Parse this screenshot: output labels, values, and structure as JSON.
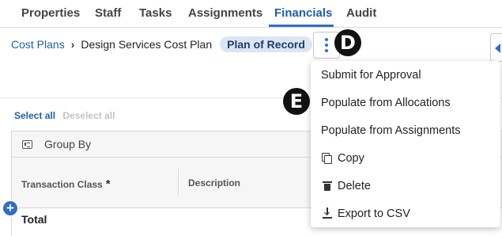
{
  "tabs": [
    {
      "label": "Properties"
    },
    {
      "label": "Staff"
    },
    {
      "label": "Tasks"
    },
    {
      "label": "Assignments"
    },
    {
      "label": "Financials"
    },
    {
      "label": "Audit"
    }
  ],
  "active_tab": "Financials",
  "breadcrumb": {
    "parent": "Cost Plans",
    "separator": "›",
    "current": "Design Services Cost Plan",
    "badge": "Plan of Record"
  },
  "markers": {
    "d": "D",
    "e": "E"
  },
  "selection": {
    "select_all": "Select all",
    "deselect_all": "Deselect all"
  },
  "grid": {
    "group_by_label": "Group By",
    "columns": [
      {
        "label": "Transaction Class",
        "required_mark": "*"
      },
      {
        "label": "Description"
      }
    ],
    "total_label": "Total",
    "add_row_glyph": "+"
  },
  "menu": {
    "items": [
      {
        "label": "Submit for Approval",
        "icon": null
      },
      {
        "label": "Populate from Allocations",
        "icon": null
      },
      {
        "label": "Populate from Assignments",
        "icon": null
      },
      {
        "label": "Copy",
        "icon": "copy-icon"
      },
      {
        "label": "Delete",
        "icon": "trash-icon"
      },
      {
        "label": "Export to CSV",
        "icon": "export-icon"
      }
    ]
  },
  "colors": {
    "accent": "#2f6ec6",
    "link": "#1f5fa8",
    "badge_bg": "#dbe6f5"
  }
}
